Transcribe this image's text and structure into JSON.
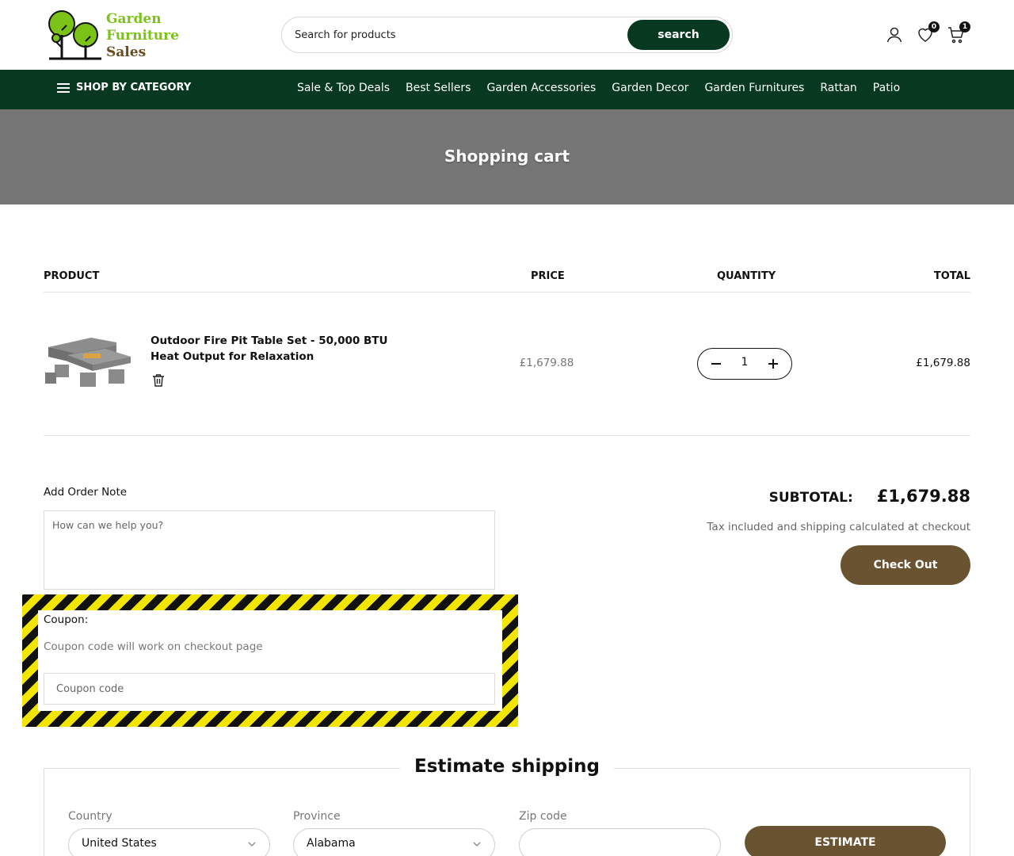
{
  "brand": {
    "line1": "Garden",
    "line2": "Furniture",
    "line3": "Sales"
  },
  "header": {
    "search_placeholder": "Search for products",
    "search_button": "search",
    "wishlist_count": "0",
    "cart_count": "1"
  },
  "nav": {
    "shop_by_category": "SHOP BY CATEGORY",
    "links": [
      "Sale & Top Deals",
      "Best Sellers",
      "Garden Accessories",
      "Garden Decor",
      "Garden Furnitures",
      "Rattan",
      "Patio"
    ]
  },
  "page": {
    "title": "Shopping cart"
  },
  "table": {
    "headers": {
      "product": "PRODUCT",
      "price": "PRICE",
      "quantity": "QUANTITY",
      "total": "TOTAL"
    },
    "items": [
      {
        "name": "Outdoor Fire Pit Table Set - 50,000 BTU Heat Output for Relaxation",
        "price": "£1,679.88",
        "quantity": "1",
        "total": "£1,679.88"
      }
    ]
  },
  "order_note": {
    "label": "Add Order Note",
    "placeholder": "How can we help you?"
  },
  "coupon": {
    "label": "Coupon:",
    "note": "Coupon code will work on checkout page",
    "placeholder": "Coupon code"
  },
  "summary": {
    "subtotal_label": "SUBTOTAL:",
    "subtotal_value": "£1,679.88",
    "tax_note": "Tax included and shipping calculated at checkout",
    "checkout_button": "Check Out"
  },
  "shipping": {
    "title": "Estimate shipping",
    "country_label": "Country",
    "country_value": "United States",
    "province_label": "Province",
    "province_value": "Alabama",
    "zip_label": "Zip code",
    "zip_value": "",
    "estimate_button": "ESTIMATE"
  },
  "colors": {
    "brand_green": "#06391f",
    "accent_brown": "#6a5330",
    "banner_gray": "#767676",
    "logo_green": "#7cc318",
    "highlight_yellow": "#f2e600"
  },
  "icons": [
    "logo-tree-icon",
    "account-icon",
    "wishlist-heart-icon",
    "cart-icon",
    "menu-icon",
    "trash-icon",
    "minus-icon",
    "plus-icon",
    "chevron-down-icon"
  ]
}
